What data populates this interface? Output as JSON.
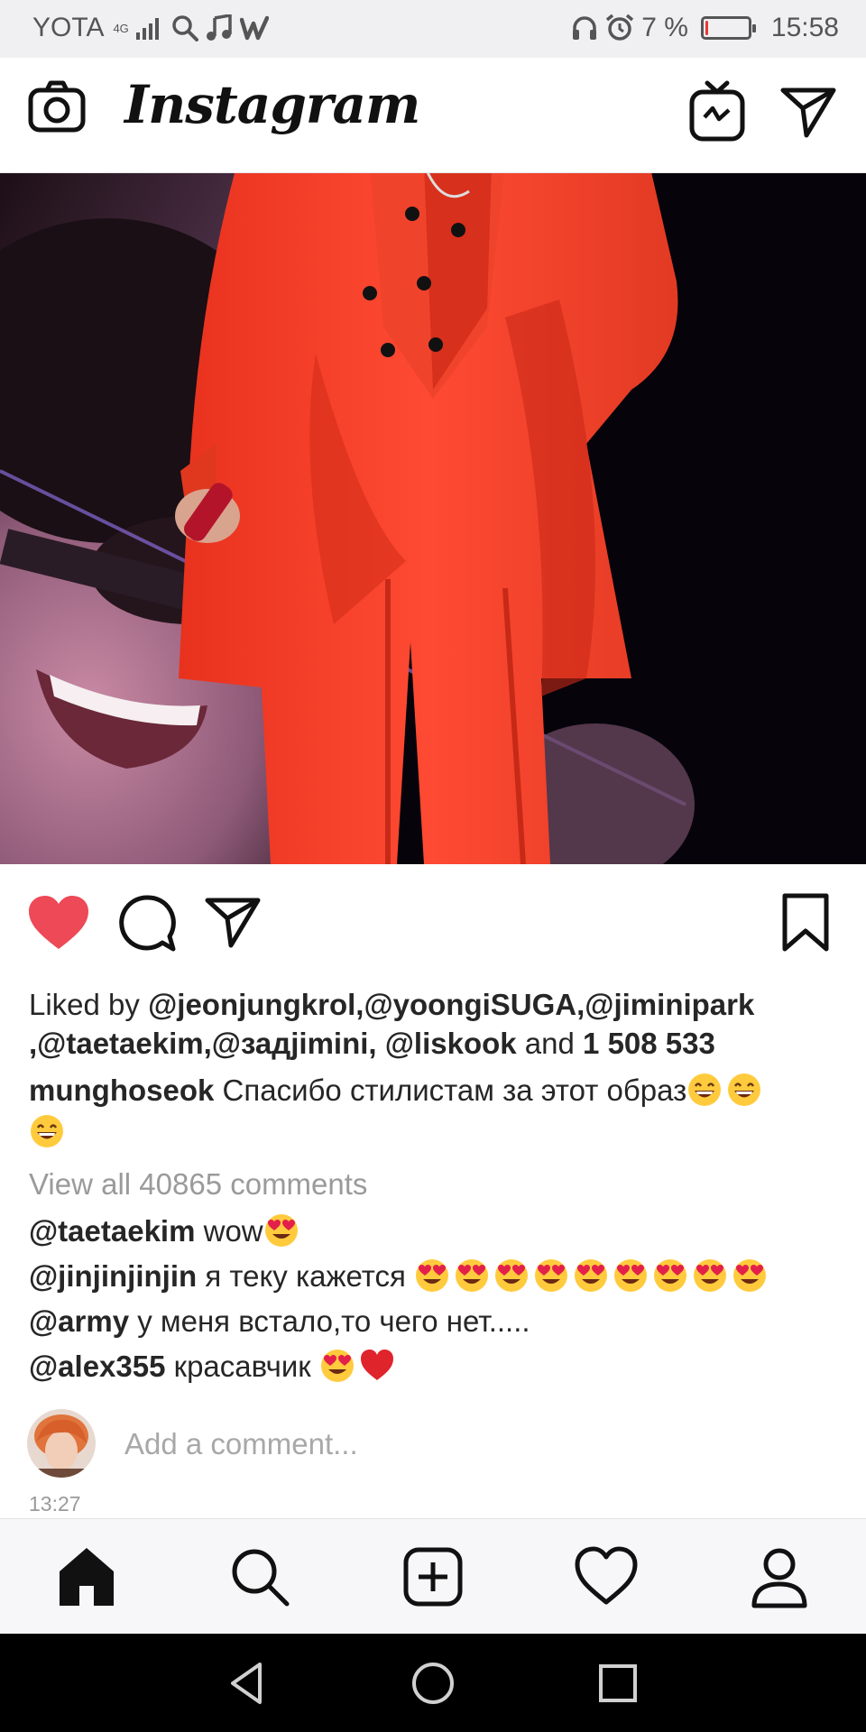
{
  "status_bar": {
    "carrier": "YOTA",
    "network_top": "4G",
    "network_bottom": "",
    "battery_percent_label": "7 %",
    "battery_level": 0.07,
    "time": "15:58",
    "icons": [
      "signal-icon",
      "search-icon",
      "music-icon",
      "w-app-icon",
      "headphones-icon",
      "alarm-icon",
      "battery-icon"
    ]
  },
  "header": {
    "app_name": "Instagram",
    "icons": [
      "camera-icon",
      "igtv-icon",
      "direct-message-icon"
    ]
  },
  "post": {
    "actions": [
      "like-icon",
      "comment-icon",
      "share-icon",
      "bookmark-icon"
    ],
    "like_filled_color": "#ed4956",
    "likes": {
      "prefix": "Liked by ",
      "users": [
        "@jeonjungkrol,",
        "@yoongiSUGA,",
        "@jiminipark",
        ",@taetaekim,",
        "@задjimini,",
        " @liskook"
      ],
      "conjunction": " and ",
      "count": "1 508 533"
    },
    "caption": {
      "username": "munghoseok",
      "text": " Спасибо стилистам за этот образ"
    },
    "view_all": "View all 40865 comments",
    "comments": [
      {
        "user": "@taetaekim",
        "text": " wow",
        "emojis": [
          "heart-eyes"
        ]
      },
      {
        "user": "@jinjinjinjin",
        "text": " я теку кажется ",
        "emojis": [
          "heart-eyes",
          "heart-eyes",
          "heart-eyes",
          "heart-eyes",
          "heart-eyes",
          "heart-eyes",
          "heart-eyes",
          "heart-eyes",
          "heart-eyes"
        ]
      },
      {
        "user": "@army",
        "text": " у меня встало,то чего нет.....",
        "emojis": []
      },
      {
        "user": "@alex355",
        "text": " красавчик ",
        "emojis": [
          "heart-eyes",
          "red-heart"
        ]
      }
    ],
    "add_comment_placeholder": "Add a comment...",
    "time": "13:27"
  },
  "tab_bar": {
    "tabs": [
      "home-icon",
      "search-icon",
      "new-post-icon",
      "activity-icon",
      "profile-icon"
    ]
  },
  "nav_bar": {
    "buttons": [
      "back-icon",
      "home-circle-icon",
      "recents-icon"
    ]
  }
}
